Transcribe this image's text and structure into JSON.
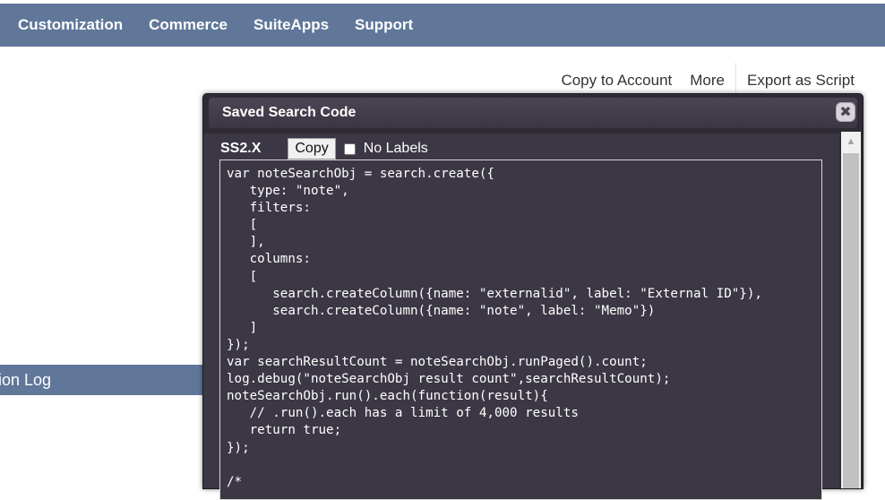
{
  "nav": {
    "items": [
      "Customization",
      "Commerce",
      "SuiteApps",
      "Support"
    ]
  },
  "actions": {
    "copy_to_account": "Copy to Account",
    "more": "More",
    "export_as_script": "Export as Script"
  },
  "sidebar": {
    "active_item": "tion Log"
  },
  "dialog": {
    "title": "Saved Search Code",
    "close_icon": "close-icon",
    "version_label": "SS2.X",
    "copy_label": "Copy",
    "no_labels_label": "No Labels",
    "no_labels_checked": false,
    "code": "var noteSearchObj = search.create({\n   type: \"note\",\n   filters:\n   [\n   ],\n   columns:\n   [\n      search.createColumn({name: \"externalid\", label: \"External ID\"}),\n      search.createColumn({name: \"note\", label: \"Memo\"})\n   ]\n});\nvar searchResultCount = noteSearchObj.runPaged().count;\nlog.debug(\"noteSearchObj result count\",searchResultCount);\nnoteSearchObj.run().each(function(result){\n   // .run().each has a limit of 4,000 results\n   return true;\n});\n\n/*"
  },
  "colors": {
    "nav_bg": "#607799",
    "dialog_bg": "#2f2b34",
    "code_bg": "#3c3744"
  }
}
